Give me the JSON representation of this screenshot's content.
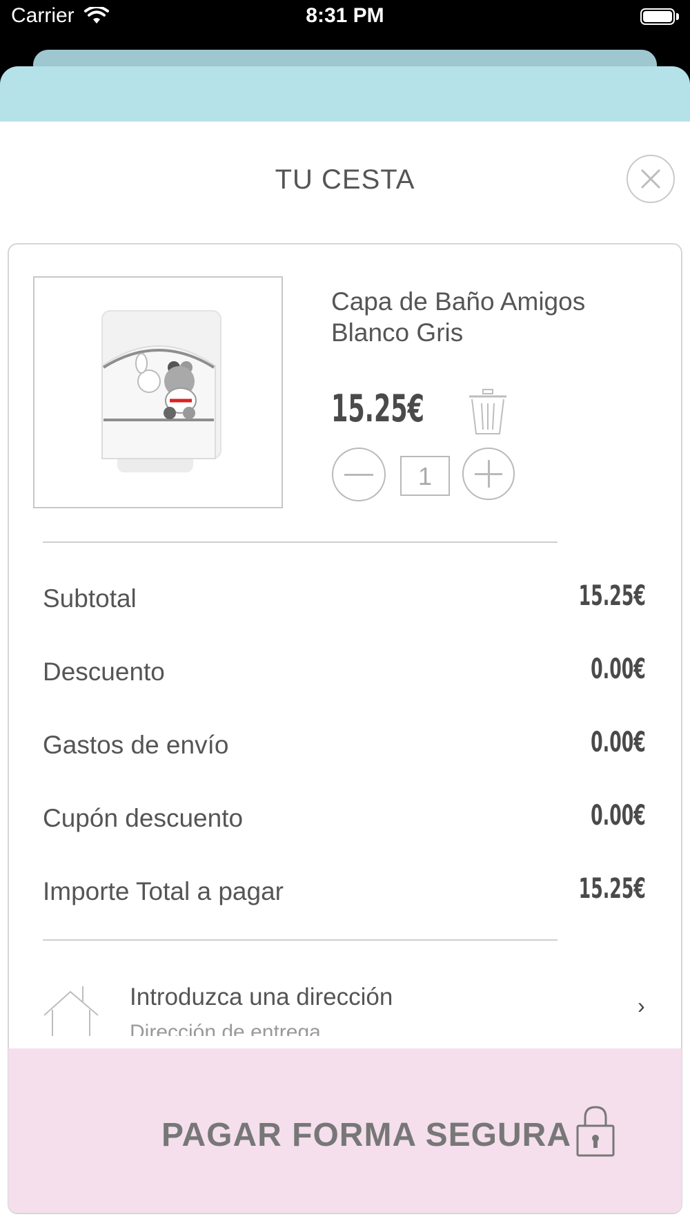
{
  "status_bar": {
    "carrier": "Carrier",
    "time": "8:31 PM"
  },
  "cart": {
    "title": "TU CESTA",
    "item": {
      "name": "Capa de Baño Amigos Blanco Gris",
      "price": "15.25€",
      "quantity": "1"
    },
    "summary": [
      {
        "label": "Subtotal",
        "value": "15.25€"
      },
      {
        "label": "Descuento",
        "value": "0.00€"
      },
      {
        "label": "Gastos de envío",
        "value": "0.00€"
      },
      {
        "label": "Cupón descuento",
        "value": "0.00€"
      },
      {
        "label": "Importe Total a pagar",
        "value": "15.25€"
      }
    ],
    "address": {
      "title": "Introduzca una dirección",
      "subtitle": "Dirección de entrega",
      "chevron": "›"
    },
    "pay_button": "PAGAR FORMA SEGURA"
  },
  "colors": {
    "header_teal": "#b5e1e9",
    "back_sheet": "#9fc7d0",
    "pay_pink": "#f5dfec",
    "text": "#555555"
  },
  "icons": [
    "wifi-icon",
    "battery-icon",
    "close-icon",
    "trash-icon",
    "minus-icon",
    "plus-icon",
    "house-icon",
    "chevron-right-icon",
    "lock-icon"
  ]
}
